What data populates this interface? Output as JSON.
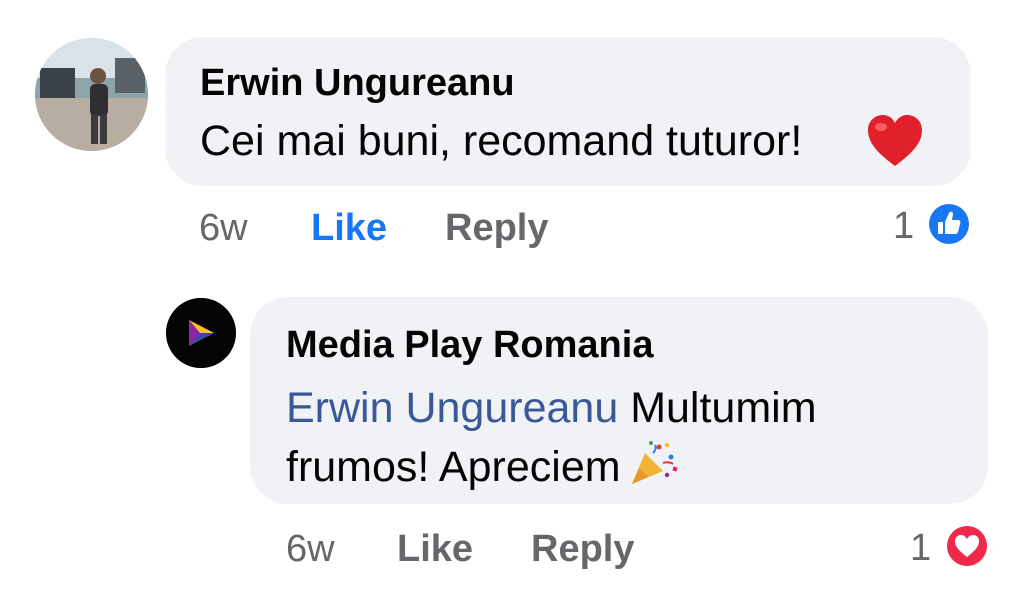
{
  "comments": [
    {
      "author": "Erwin Ungureanu",
      "text": "Cei mai buni, recomand tuturor!",
      "emoji_icon": "red-heart-emoji",
      "time": "6w",
      "like_label": "Like",
      "reply_label": "Reply",
      "reaction_count": "1",
      "reaction_icon": "like-reaction-icon",
      "liked_by_viewer": true
    }
  ],
  "replies": [
    {
      "author": "Media Play Romania",
      "mention": "Erwin Ungureanu",
      "text": "Multumim frumos! Apreciem",
      "emoji_icon": "party-popper-emoji",
      "time": "6w",
      "like_label": "Like",
      "reply_label": "Reply",
      "reaction_count": "1",
      "reaction_icon": "love-reaction-icon"
    }
  ],
  "colors": {
    "bubble": "#f0f2f5",
    "like_active": "#1877f2",
    "mention": "#385898",
    "meta": "#65676b"
  }
}
